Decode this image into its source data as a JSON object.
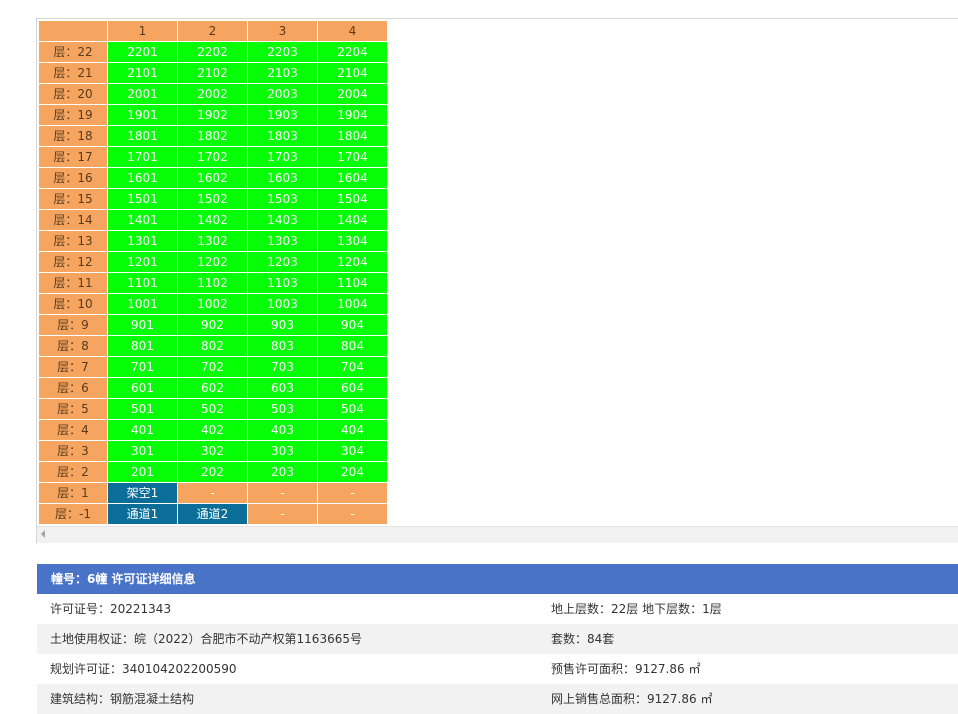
{
  "unit_table": {
    "columns": [
      "1",
      "2",
      "3",
      "4"
    ],
    "rows": [
      {
        "floor": "层：22",
        "units": [
          {
            "label": "2201",
            "status": "green"
          },
          {
            "label": "2202",
            "status": "green"
          },
          {
            "label": "2203",
            "status": "green"
          },
          {
            "label": "2204",
            "status": "green"
          }
        ]
      },
      {
        "floor": "层：21",
        "units": [
          {
            "label": "2101",
            "status": "green"
          },
          {
            "label": "2102",
            "status": "green"
          },
          {
            "label": "2103",
            "status": "green"
          },
          {
            "label": "2104",
            "status": "green"
          }
        ]
      },
      {
        "floor": "层：20",
        "units": [
          {
            "label": "2001",
            "status": "green"
          },
          {
            "label": "2002",
            "status": "green"
          },
          {
            "label": "2003",
            "status": "green"
          },
          {
            "label": "2004",
            "status": "green"
          }
        ]
      },
      {
        "floor": "层：19",
        "units": [
          {
            "label": "1901",
            "status": "green"
          },
          {
            "label": "1902",
            "status": "green"
          },
          {
            "label": "1903",
            "status": "green"
          },
          {
            "label": "1904",
            "status": "green"
          }
        ]
      },
      {
        "floor": "层：18",
        "units": [
          {
            "label": "1801",
            "status": "green"
          },
          {
            "label": "1802",
            "status": "green"
          },
          {
            "label": "1803",
            "status": "green"
          },
          {
            "label": "1804",
            "status": "green"
          }
        ]
      },
      {
        "floor": "层：17",
        "units": [
          {
            "label": "1701",
            "status": "green"
          },
          {
            "label": "1702",
            "status": "green"
          },
          {
            "label": "1703",
            "status": "green"
          },
          {
            "label": "1704",
            "status": "green"
          }
        ]
      },
      {
        "floor": "层：16",
        "units": [
          {
            "label": "1601",
            "status": "green"
          },
          {
            "label": "1602",
            "status": "green"
          },
          {
            "label": "1603",
            "status": "green"
          },
          {
            "label": "1604",
            "status": "green"
          }
        ]
      },
      {
        "floor": "层：15",
        "units": [
          {
            "label": "1501",
            "status": "green"
          },
          {
            "label": "1502",
            "status": "green"
          },
          {
            "label": "1503",
            "status": "green"
          },
          {
            "label": "1504",
            "status": "green"
          }
        ]
      },
      {
        "floor": "层：14",
        "units": [
          {
            "label": "1401",
            "status": "green"
          },
          {
            "label": "1402",
            "status": "green"
          },
          {
            "label": "1403",
            "status": "green"
          },
          {
            "label": "1404",
            "status": "green"
          }
        ]
      },
      {
        "floor": "层：13",
        "units": [
          {
            "label": "1301",
            "status": "green"
          },
          {
            "label": "1302",
            "status": "green"
          },
          {
            "label": "1303",
            "status": "green"
          },
          {
            "label": "1304",
            "status": "green"
          }
        ]
      },
      {
        "floor": "层：12",
        "units": [
          {
            "label": "1201",
            "status": "green"
          },
          {
            "label": "1202",
            "status": "green"
          },
          {
            "label": "1203",
            "status": "green"
          },
          {
            "label": "1204",
            "status": "green"
          }
        ]
      },
      {
        "floor": "层：11",
        "units": [
          {
            "label": "1101",
            "status": "green"
          },
          {
            "label": "1102",
            "status": "green"
          },
          {
            "label": "1103",
            "status": "green"
          },
          {
            "label": "1104",
            "status": "green"
          }
        ]
      },
      {
        "floor": "层：10",
        "units": [
          {
            "label": "1001",
            "status": "green"
          },
          {
            "label": "1002",
            "status": "green"
          },
          {
            "label": "1003",
            "status": "green"
          },
          {
            "label": "1004",
            "status": "green"
          }
        ]
      },
      {
        "floor": "层：9",
        "units": [
          {
            "label": "901",
            "status": "green"
          },
          {
            "label": "902",
            "status": "green"
          },
          {
            "label": "903",
            "status": "green"
          },
          {
            "label": "904",
            "status": "green"
          }
        ]
      },
      {
        "floor": "层：8",
        "units": [
          {
            "label": "801",
            "status": "green"
          },
          {
            "label": "802",
            "status": "green"
          },
          {
            "label": "803",
            "status": "green"
          },
          {
            "label": "804",
            "status": "green"
          }
        ]
      },
      {
        "floor": "层：7",
        "units": [
          {
            "label": "701",
            "status": "green"
          },
          {
            "label": "702",
            "status": "green"
          },
          {
            "label": "703",
            "status": "green"
          },
          {
            "label": "704",
            "status": "green"
          }
        ]
      },
      {
        "floor": "层：6",
        "units": [
          {
            "label": "601",
            "status": "green"
          },
          {
            "label": "602",
            "status": "green"
          },
          {
            "label": "603",
            "status": "green"
          },
          {
            "label": "604",
            "status": "green"
          }
        ]
      },
      {
        "floor": "层：5",
        "units": [
          {
            "label": "501",
            "status": "green"
          },
          {
            "label": "502",
            "status": "green"
          },
          {
            "label": "503",
            "status": "green"
          },
          {
            "label": "504",
            "status": "green"
          }
        ]
      },
      {
        "floor": "层：4",
        "units": [
          {
            "label": "401",
            "status": "green"
          },
          {
            "label": "402",
            "status": "green"
          },
          {
            "label": "403",
            "status": "green"
          },
          {
            "label": "404",
            "status": "green"
          }
        ]
      },
      {
        "floor": "层：3",
        "units": [
          {
            "label": "301",
            "status": "green"
          },
          {
            "label": "302",
            "status": "green"
          },
          {
            "label": "303",
            "status": "green"
          },
          {
            "label": "304",
            "status": "green"
          }
        ]
      },
      {
        "floor": "层：2",
        "units": [
          {
            "label": "201",
            "status": "green"
          },
          {
            "label": "202",
            "status": "green"
          },
          {
            "label": "203",
            "status": "green"
          },
          {
            "label": "204",
            "status": "green"
          }
        ]
      },
      {
        "floor": "层：1",
        "units": [
          {
            "label": "架空1",
            "status": "blue"
          },
          {
            "label": "-",
            "status": "orange"
          },
          {
            "label": "-",
            "status": "orange"
          },
          {
            "label": "-",
            "status": "orange"
          }
        ]
      },
      {
        "floor": "层：-1",
        "units": [
          {
            "label": "通道1",
            "status": "blue"
          },
          {
            "label": "通道2",
            "status": "blue"
          },
          {
            "label": "-",
            "status": "orange"
          },
          {
            "label": "-",
            "status": "orange"
          }
        ]
      }
    ]
  },
  "colors": {
    "header_bg": "#f5a560",
    "available": "#06ff06",
    "special": "#0b6e99",
    "empty": "#f5a560",
    "panel_header": "#4873c6"
  },
  "info": {
    "title": "幢号：6幢 许可证详细信息",
    "rows": [
      {
        "left": "许可证号：20221343",
        "right": "地上层数：22层 地下层数：1层"
      },
      {
        "left": "土地使用权证：皖（2022）合肥市不动产权第1163665号",
        "right": "套数：84套"
      },
      {
        "left": "规划许可证：340104202200590",
        "right": "预售许可面积：9127.86 ㎡"
      },
      {
        "left": "建筑结构：钢筋混凝土结构",
        "right": "网上销售总面积：9127.86 ㎡"
      }
    ]
  }
}
